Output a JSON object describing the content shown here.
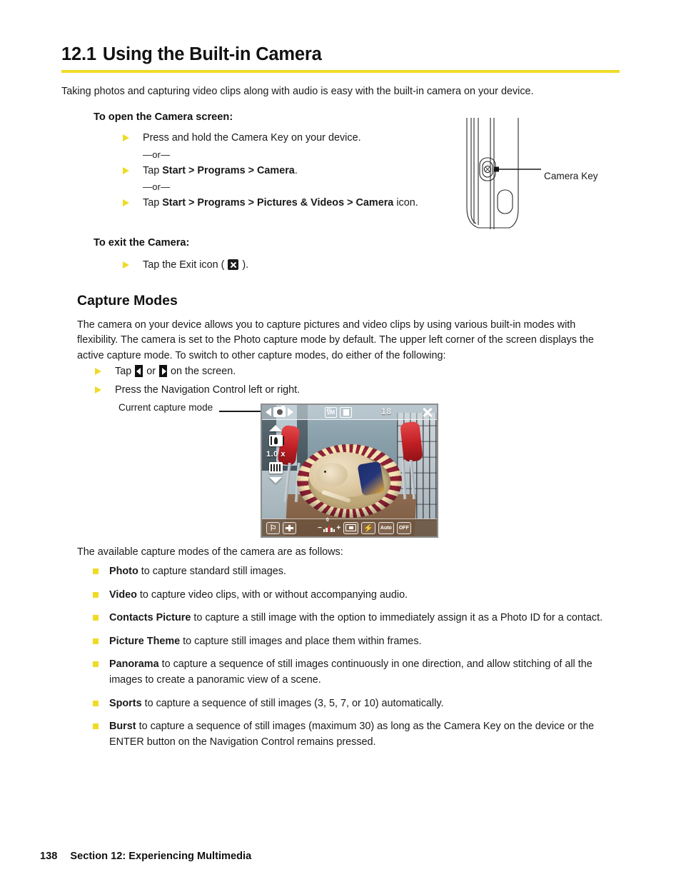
{
  "heading": {
    "number": "12.1",
    "title": "Using the Built-in Camera",
    "rule_color": "#efdb25"
  },
  "intro": "Taking photos and capturing video clips along with audio is easy with the built-in camera on your device.",
  "sections": {
    "open_camera": {
      "subhead": "To open the Camera screen:",
      "items": [
        {
          "text": "Press and hold the Camera Key on your device."
        },
        {
          "or": "—or—"
        },
        {
          "pre": "Tap ",
          "bold1": "Start",
          "sep1": " > ",
          "bold2": "Programs",
          "sep2": " > ",
          "bold3": "Camera",
          "post": "."
        },
        {
          "or": "—or—"
        },
        {
          "pre": "Tap ",
          "bold1": "Start",
          "sep1": " > ",
          "bold2": "Programs",
          "sep2": " > ",
          "bold3": "Pictures & Videos",
          "sep3": " > ",
          "bold4": "Camera",
          "post": " icon."
        }
      ]
    },
    "exit_camera": {
      "subhead": "To exit the Camera:",
      "item_pre": "Tap the Exit icon ( ",
      "item_post": " ).",
      "icon": "exit-x-icon"
    },
    "capture_modes": {
      "heading": "Capture Modes",
      "paragraph": "The camera on your device allows you to capture pictures and video clips by using various built-in modes with flexibility. The camera is set to the Photo capture mode by default. The upper left corner of the screen displays the active capture mode. To switch to other capture modes, do either of the following:",
      "switch_items": [
        {
          "pre": "Tap ",
          "mid": " or ",
          "post": " on the screen.",
          "icon_left": "arrow-left-chip-icon",
          "icon_right": "arrow-right-chip-icon"
        },
        {
          "text": "Press the Navigation Control left or right."
        }
      ],
      "available_intro": "The available capture modes of the camera are as follows:",
      "modes": [
        {
          "name": "Photo",
          "desc": " to capture standard still images."
        },
        {
          "name": "Video",
          "desc": " to capture video clips, with or without accompanying audio."
        },
        {
          "name": "Contacts Picture",
          "desc": " to capture a still image with the option to immediately assign it as a Photo ID for a contact."
        },
        {
          "name": "Picture Theme",
          "desc": " to capture still images and place them within frames."
        },
        {
          "name": "Panorama",
          "desc": " to capture a sequence of still images continuously in one direction, and allow stitching of all the images to create a panoramic view of a scene."
        },
        {
          "name": "Sports",
          "desc": " to capture a sequence of still images (3, 5, 7, or 10) automatically."
        },
        {
          "name": "Burst",
          "desc": " to capture a sequence of still images (maximum 30) as long as the Camera Key on the device or the ENTER button on the Navigation Control remains pressed."
        }
      ]
    }
  },
  "device_figure": {
    "callout_label": "Camera Key",
    "alt": "side view of device showing camera key"
  },
  "camera_screenshot": {
    "callout_label": "Current capture mode",
    "top_bar": {
      "mode_icon": "photo-camera-icon",
      "left_arrow": "mode-prev-arrow-icon",
      "right_arrow": "mode-next-arrow-icon",
      "resolution": "2M",
      "storage_icon": "storage-card-icon",
      "counter": "18",
      "exit_icon": "close-x-icon"
    },
    "zoom_controls": {
      "up": "zoom-up-arrow-icon",
      "tele": "tele-zoom-icon",
      "level": "1.0 x",
      "wide": "wide-zoom-icon",
      "down": "zoom-down-arrow-icon"
    },
    "bottom_bar": {
      "settings_icon": "wrench-settings-icon",
      "album_icon": "album-icon",
      "ev_minus": "−",
      "ev_value": "0",
      "ev_plus": "+",
      "focus_icon": "focus-mode-icon",
      "flash_icon": "flash-off-icon",
      "wb_label": "Auto",
      "wb_icon": "white-balance-icon",
      "timer_label": "OFF",
      "timer_icon": "self-timer-icon"
    }
  },
  "footer": {
    "page_number": "138",
    "section_label": "Section 12: Experiencing Multimedia"
  }
}
